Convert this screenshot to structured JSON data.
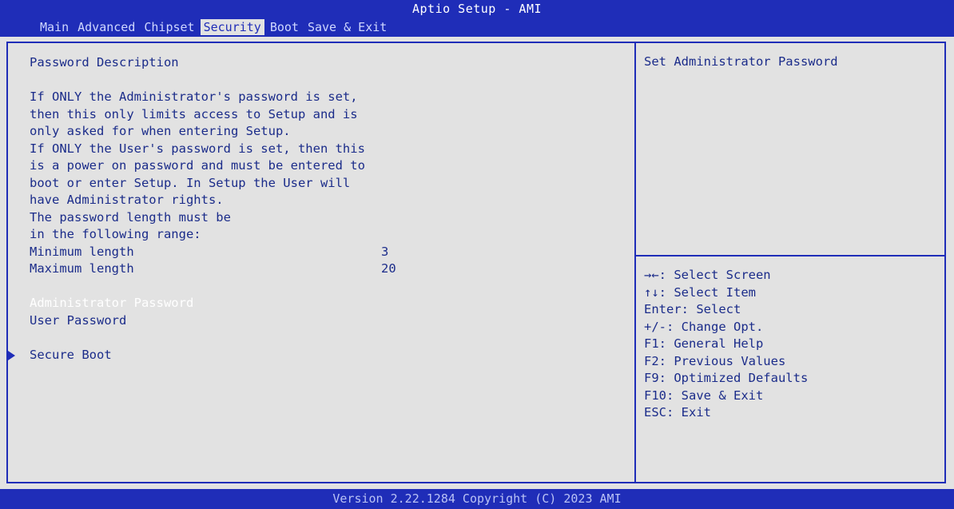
{
  "window": {
    "title": "Aptio Setup - AMI"
  },
  "tabs": [
    {
      "label": "Main"
    },
    {
      "label": "Advanced"
    },
    {
      "label": "Chipset"
    },
    {
      "label": "Security"
    },
    {
      "label": "Boot"
    },
    {
      "label": "Save & Exit"
    }
  ],
  "active_tab": "Security",
  "description": {
    "heading": "Password Description",
    "lines": [
      "If ONLY the Administrator's password is set,",
      "then this only limits access to Setup and is",
      "only asked for when entering Setup.",
      "If ONLY the User's password is set, then this",
      "is a power on password and must be entered to",
      "boot or enter Setup. In Setup the User will",
      "have Administrator rights.",
      "The password length must be",
      "in the following range:"
    ],
    "min_label": "Minimum length",
    "min_value": "3",
    "max_label": "Maximum length",
    "max_value": "20"
  },
  "menu": {
    "admin_password": "Administrator Password",
    "user_password": "User Password",
    "secure_boot": "Secure Boot"
  },
  "help": {
    "title": "Set Administrator Password",
    "keys": [
      "→←: Select Screen",
      "↑↓: Select Item",
      "Enter: Select",
      "+/-: Change Opt.",
      "F1: General Help",
      "F2: Previous Values",
      "F9: Optimized Defaults",
      "F10: Save & Exit",
      "ESC: Exit"
    ]
  },
  "footer": {
    "text": "Version 2.22.1284 Copyright (C) 2023 AMI"
  },
  "colors": {
    "header": "#1f2db8",
    "background": "#e2e2e2",
    "text": "#1b2c8a"
  }
}
